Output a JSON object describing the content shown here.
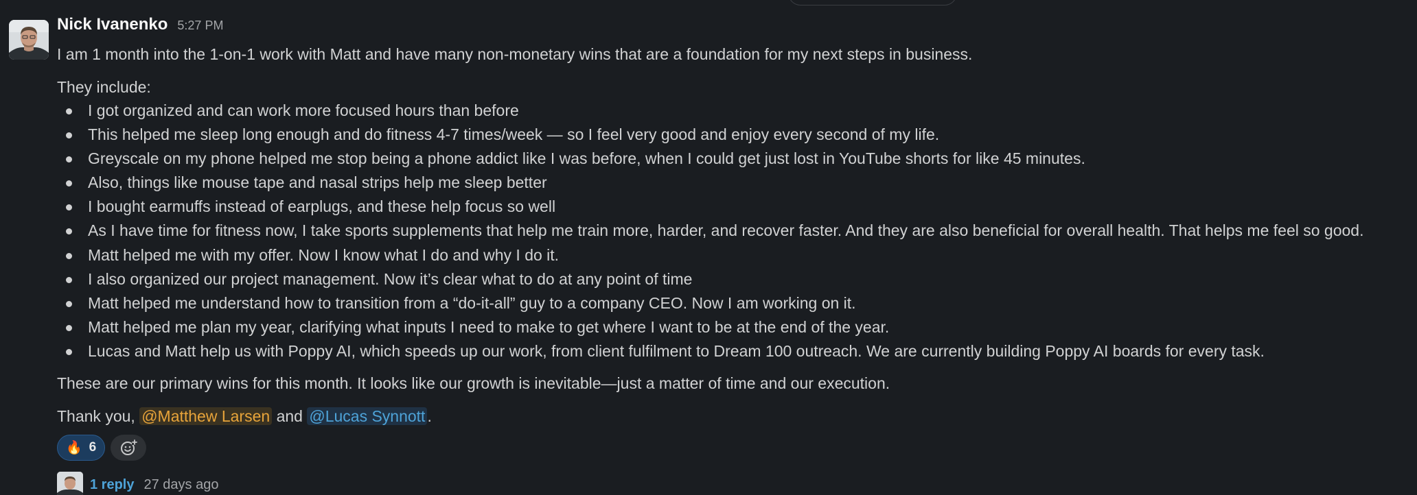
{
  "message": {
    "author": "Nick Ivanenko",
    "time": "5:27 PM",
    "intro": "I am 1 month into the 1-on-1 work with Matt and have many non-monetary wins that are a foundation for my next steps in business.",
    "list_intro": "They include:",
    "bullets": [
      "I got organized and can work more focused hours than before",
      "This helped me sleep long enough and do fitness 4-7 times/week — so I feel very good and enjoy every second of my life.",
      "Greyscale on my phone helped me stop being a phone addict like I was before, when I could get just lost in YouTube shorts for like 45 minutes.",
      "Also, things like mouse tape and nasal strips help me sleep better",
      "I bought earmuffs instead of earplugs, and these help focus so well",
      "As I have time for fitness now, I take sports supplements that help me train more, harder, and recover faster. And they are also beneficial for overall health. That helps me feel so good.",
      "Matt helped me with my offer. Now I know what I do and why I do it.",
      "I also organized our project management. Now it’s clear what to do at any point of time",
      "Matt helped me understand how to transition from a “do-it-all” guy to a company CEO. Now I am working on it.",
      "Matt helped me plan my year, clarifying what inputs I need to make to get where I want to be at the end of the year.",
      "Lucas and Matt help us with Poppy AI, which speeds up our work, from client fulfilment to Dream 100 outreach. We are currently building Poppy AI boards for every task."
    ],
    "wins": "These are our primary wins for this month. It looks like our growth is inevitable—just a matter of time and our execution.",
    "thanks_prefix": "Thank you,",
    "mention_1": "@Matthew Larsen",
    "thanks_and": "and",
    "mention_2": "@Lucas Synnott",
    "thanks_suffix": "."
  },
  "reactions": [
    {
      "emoji": "🔥",
      "icon": "fire-icon",
      "count": "6"
    }
  ],
  "add_reaction_icon": "add-emoji-icon",
  "thread": {
    "replies": "1 reply",
    "last_reply": "27 days ago"
  },
  "colors": {
    "background": "#1a1d21",
    "text": "#d1d2d3",
    "mention_self": "#e8a43a",
    "mention_other": "#4ea3d8",
    "link": "#4ea3d8"
  }
}
